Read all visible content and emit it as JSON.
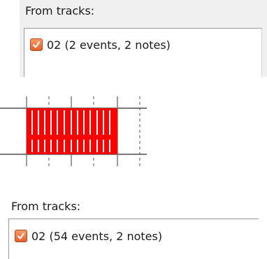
{
  "panel_top": {
    "label": "From tracks:",
    "items": [
      {
        "checked": true,
        "label": "02 (2 events, 2 notes)"
      }
    ]
  },
  "panel_bottom": {
    "label": "From tracks:",
    "items": [
      {
        "checked": true,
        "label": "02 (54 events, 2 notes)"
      }
    ]
  },
  "colors": {
    "selection_fill": "#ff0000",
    "checkbox_fill": "#e8743f",
    "track_line": "#7a7a7a"
  }
}
